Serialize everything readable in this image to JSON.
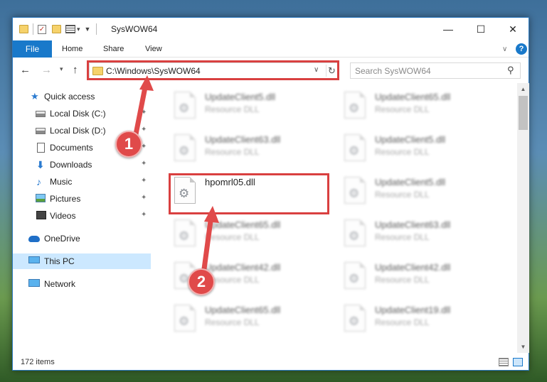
{
  "window": {
    "title": "SysWOW64"
  },
  "ribbon": {
    "tabs": [
      "File",
      "Home",
      "Share",
      "View"
    ]
  },
  "window_controls": {
    "minimize": "—",
    "maximize": "☐",
    "close": "✕"
  },
  "address": {
    "path": "C:\\Windows\\SysWOW64"
  },
  "search": {
    "placeholder": "Search SysWOW64"
  },
  "sidebar": {
    "items": [
      {
        "label": "Quick access",
        "icon": "star-icon"
      },
      {
        "label": "Local Disk (C:)",
        "icon": "disk-icon",
        "pinned": true
      },
      {
        "label": "Local Disk (D:)",
        "icon": "disk-icon",
        "pinned": true
      },
      {
        "label": "Documents",
        "icon": "document-icon",
        "pinned": true
      },
      {
        "label": "Downloads",
        "icon": "download-icon",
        "pinned": true
      },
      {
        "label": "Music",
        "icon": "music-icon",
        "pinned": true
      },
      {
        "label": "Pictures",
        "icon": "pictures-icon",
        "pinned": true
      },
      {
        "label": "Videos",
        "icon": "video-icon",
        "pinned": true
      },
      {
        "label": "OneDrive",
        "icon": "cloud-icon"
      },
      {
        "label": "This PC",
        "icon": "computer-icon",
        "selected": true
      },
      {
        "label": "Network",
        "icon": "network-icon"
      }
    ]
  },
  "files": [
    {
      "name": "UpdateClient5.dll",
      "type": "Resource DLL",
      "blurred": true
    },
    {
      "name": "UpdateClient65.dll",
      "type": "Resource DLL",
      "blurred": true
    },
    {
      "name": "UpdateClient63.dll",
      "type": "Resource DLL",
      "blurred": true
    },
    {
      "name": "UpdateClient5.dll",
      "type": "Resource DLL",
      "blurred": true
    },
    {
      "name": "hpomrl05.dll",
      "type": "",
      "blurred": false
    },
    {
      "name": "UpdateClient5.dll",
      "type": "Resource DLL",
      "blurred": true
    },
    {
      "name": "UpdateClient65.dll",
      "type": "Resource DLL",
      "blurred": true
    },
    {
      "name": "UpdateClient63.dll",
      "type": "Resource DLL",
      "blurred": true
    },
    {
      "name": "UpdateClient42.dll",
      "type": "Resource DLL",
      "blurred": true
    },
    {
      "name": "UpdateClient42.dll",
      "type": "Resource DLL",
      "blurred": true
    },
    {
      "name": "UpdateClient65.dll",
      "type": "Resource DLL",
      "blurred": true
    },
    {
      "name": "UpdateClient19.dll",
      "type": "Resource DLL",
      "blurred": true
    }
  ],
  "status": {
    "item_count": "172 items"
  },
  "annotations": {
    "callout_1": "1",
    "callout_2": "2",
    "highlight_color": "#d94040"
  },
  "colors": {
    "accent": "#1979ca",
    "selection": "#cce8ff"
  }
}
